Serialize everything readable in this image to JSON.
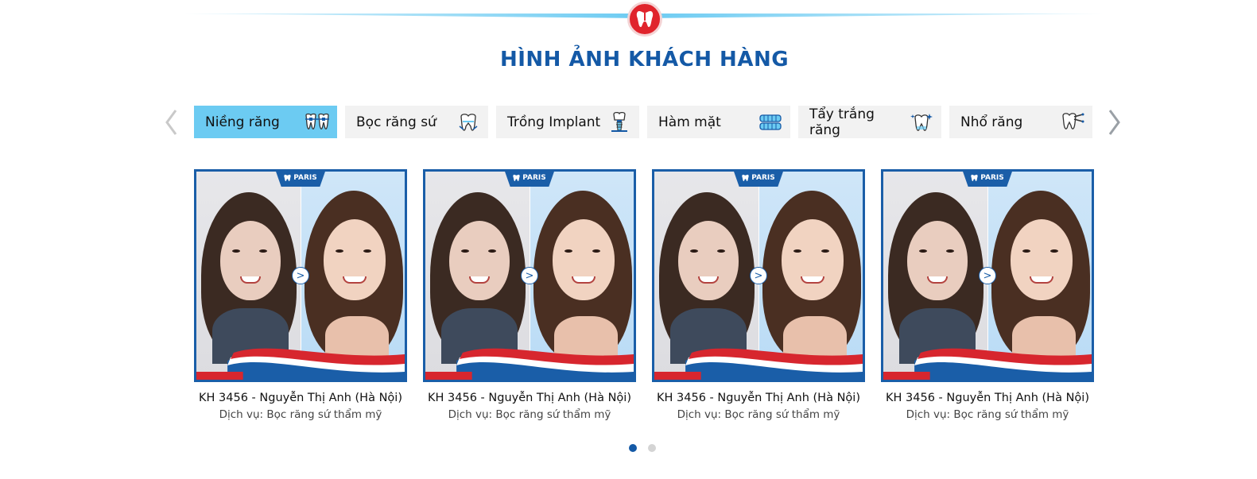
{
  "section": {
    "title": "HÌNH ẢNH KHÁCH HÀNG",
    "accent_color": "#1459a6",
    "badge_color": "#e0242c",
    "badge_icon": "tooth-icon"
  },
  "carousel_nav": {
    "prev_icon": "chevron-left-icon",
    "next_icon": "chevron-right-icon"
  },
  "tabs": [
    {
      "label": "Niềng răng",
      "icon": "braces-icon",
      "active": true
    },
    {
      "label": "Bọc răng sứ",
      "icon": "crown-tooth-icon",
      "active": false
    },
    {
      "label": "Trồng Implant",
      "icon": "implant-icon",
      "active": false
    },
    {
      "label": "Hàm mặt",
      "icon": "jaw-icon",
      "active": false
    },
    {
      "label": "Tẩy trắng răng",
      "icon": "sparkle-tooth-icon",
      "active": false
    },
    {
      "label": "Nhổ răng",
      "icon": "extraction-icon",
      "active": false
    }
  ],
  "cards": [
    {
      "brand": "PARIS",
      "title": "KH 3456 - Nguyễn Thị Anh (Hà Nội)",
      "desc": "Dịch vụ: Bọc răng sứ thẩm mỹ"
    },
    {
      "brand": "PARIS",
      "title": "KH 3456 - Nguyễn Thị Anh (Hà Nội)",
      "desc": "Dịch vụ: Bọc răng sứ thẩm mỹ"
    },
    {
      "brand": "PARIS",
      "title": "KH 3456 - Nguyễn Thị Anh (Hà Nội)",
      "desc": "Dịch vụ: Bọc răng sứ thẩm mỹ"
    },
    {
      "brand": "PARIS",
      "title": "KH 3456 - Nguyễn Thị Anh (Hà Nội)",
      "desc": "Dịch vụ: Bọc răng sứ thẩm mỹ"
    }
  ],
  "compare_symbol": ">",
  "pagination": {
    "pages": 2,
    "current": 1
  }
}
